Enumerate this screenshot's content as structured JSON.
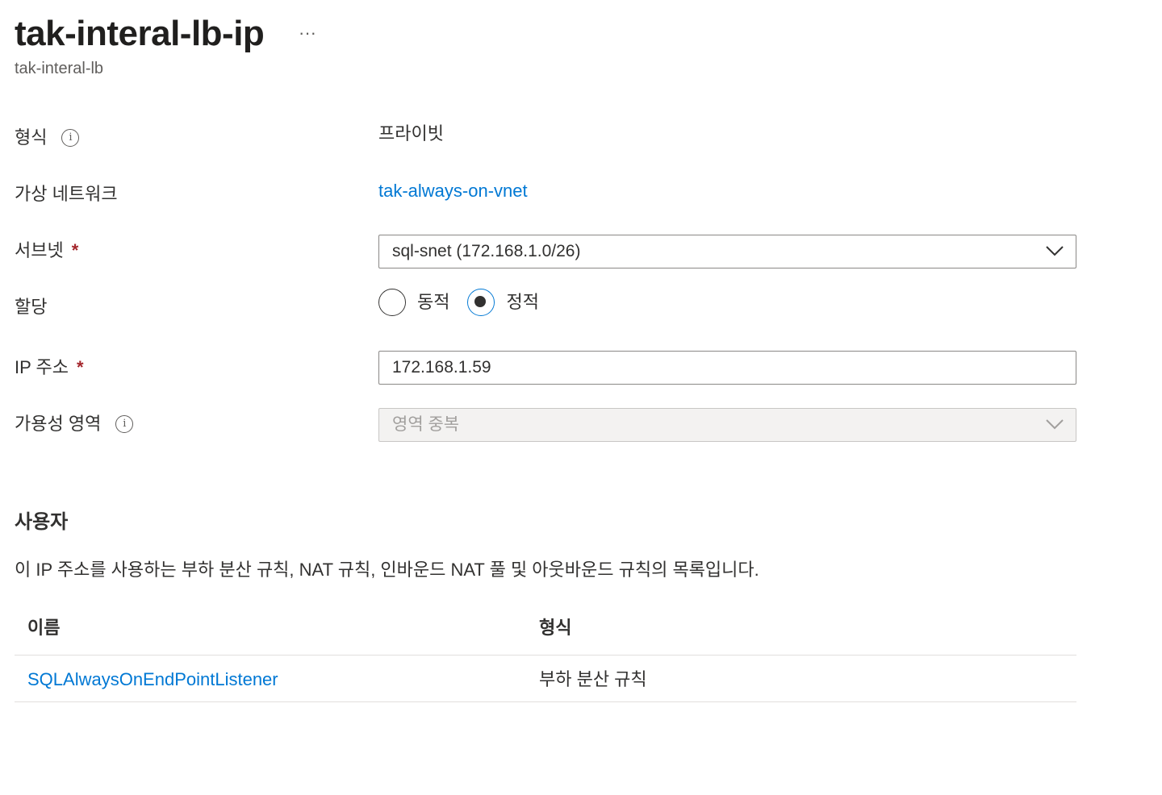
{
  "header": {
    "title": "tak-interal-lb-ip",
    "more_label": "···",
    "subtitle": "tak-interal-lb"
  },
  "form": {
    "type": {
      "label": "형식",
      "value": "프라이빗"
    },
    "vnet": {
      "label": "가상 네트워크",
      "value": "tak-always-on-vnet"
    },
    "subnet": {
      "label": "서브넷",
      "required_mark": "*",
      "value": "sql-snet (172.168.1.0/26)"
    },
    "assignment": {
      "label": "할당",
      "options": [
        {
          "label": "동적",
          "checked": false
        },
        {
          "label": "정적",
          "checked": true
        }
      ]
    },
    "ip": {
      "label": "IP 주소",
      "required_mark": "*",
      "value": "172.168.1.59"
    },
    "zone": {
      "label": "가용성 영역",
      "value": "영역 중복",
      "disabled": true
    }
  },
  "users": {
    "title": "사용자",
    "description": "이 IP 주소를 사용하는 부하 분산 규칙, NAT 규칙, 인바운드 NAT 풀 및 아웃바운드 규칙의 목록입니다.",
    "columns": [
      "이름",
      "형식"
    ],
    "rows": [
      {
        "name": "SQLAlwaysOnEndPointListener",
        "type": "부하 분산 규칙"
      }
    ]
  },
  "colors": {
    "accent": "#0078d4",
    "required": "#a4262c",
    "text": "#323130",
    "disabled_bg": "#f3f2f1"
  },
  "icons": [
    "info-icon",
    "chevron-down-icon",
    "more-icon"
  ]
}
